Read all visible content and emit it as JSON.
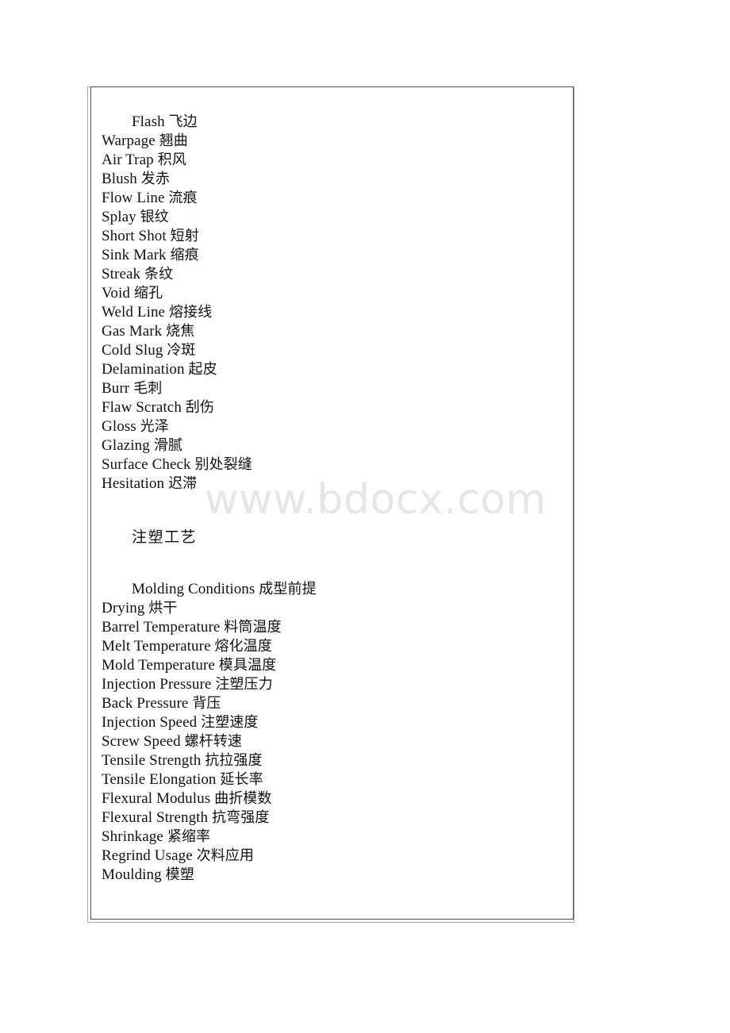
{
  "document": {
    "watermark": "www.bdocx.com",
    "frame": {
      "border_color_inner": "#4c4c4c",
      "border_color_outer": "#a8a8a8",
      "background": "#ffffff"
    },
    "text_color": "#111111"
  },
  "sections": [
    {
      "id": "defects",
      "heading": null,
      "first_line_indented": true,
      "entries": [
        {
          "en": "Flash",
          "cn": "飞边",
          "indent": true
        },
        {
          "en": "Warpage",
          "cn": "翘曲",
          "indent": false
        },
        {
          "en": "Air Trap",
          "cn": "积风",
          "indent": false
        },
        {
          "en": "Blush",
          "cn": "发赤",
          "indent": false
        },
        {
          "en": "Flow Line",
          "cn": "流痕",
          "indent": false
        },
        {
          "en": "Splay",
          "cn": "银纹",
          "indent": false
        },
        {
          "en": "Short Shot",
          "cn": "短射",
          "indent": false
        },
        {
          "en": "Sink Mark",
          "cn": "缩痕",
          "indent": false
        },
        {
          "en": "Streak",
          "cn": "条纹",
          "indent": false
        },
        {
          "en": "Void",
          "cn": "缩孔",
          "indent": false
        },
        {
          "en": "Weld Line",
          "cn": "熔接线",
          "indent": false
        },
        {
          "en": "Gas Mark",
          "cn": "烧焦",
          "indent": false
        },
        {
          "en": "Cold Slug",
          "cn": "冷斑",
          "indent": false
        },
        {
          "en": "Delamination",
          "cn": "起皮",
          "indent": false
        },
        {
          "en": "Burr",
          "cn": "毛刺",
          "indent": false
        },
        {
          "en": "Flaw Scratch",
          "cn": "刮伤",
          "indent": false
        },
        {
          "en": "Gloss",
          "cn": "光泽",
          "indent": false
        },
        {
          "en": "Glazing",
          "cn": "滑腻",
          "indent": false
        },
        {
          "en": "Surface Check",
          "cn": "别处裂缝",
          "indent": false
        },
        {
          "en": "Hesitation",
          "cn": "迟滞",
          "indent": false
        }
      ]
    },
    {
      "id": "molding-process",
      "heading": {
        "en": "",
        "cn": "注塑工艺"
      },
      "entries": []
    },
    {
      "id": "molding-conditions",
      "heading": null,
      "entries": [
        {
          "en": "Molding Conditions",
          "cn": "成型前提",
          "indent": true
        },
        {
          "en": "Drying",
          "cn": "烘干",
          "indent": false
        },
        {
          "en": "Barrel Temperature",
          "cn": "料筒温度",
          "indent": false
        },
        {
          "en": "Melt Temperature",
          "cn": "熔化温度",
          "indent": false
        },
        {
          "en": "Mold Temperature",
          "cn": "模具温度",
          "indent": false
        },
        {
          "en": "Injection Pressure",
          "cn": "注塑压力",
          "indent": false
        },
        {
          "en": "Back Pressure",
          "cn": "背压",
          "indent": false
        },
        {
          "en": "Injection Speed",
          "cn": "注塑速度",
          "indent": false
        },
        {
          "en": "Screw Speed",
          "cn": "螺杆转速",
          "indent": false
        },
        {
          "en": "Tensile Strength",
          "cn": "抗拉强度",
          "indent": false
        },
        {
          "en": "Tensile Elongation",
          "cn": "延长率",
          "indent": false
        },
        {
          "en": "Flexural Modulus",
          "cn": "曲折模数",
          "indent": false
        },
        {
          "en": "Flexural Strength",
          "cn": "抗弯强度",
          "indent": false
        },
        {
          "en": "Shrinkage",
          "cn": "紧缩率",
          "indent": false
        },
        {
          "en": "Regrind Usage",
          "cn": "次料应用",
          "indent": false
        },
        {
          "en": "Moulding",
          "cn": "模塑",
          "indent": false
        }
      ]
    }
  ]
}
